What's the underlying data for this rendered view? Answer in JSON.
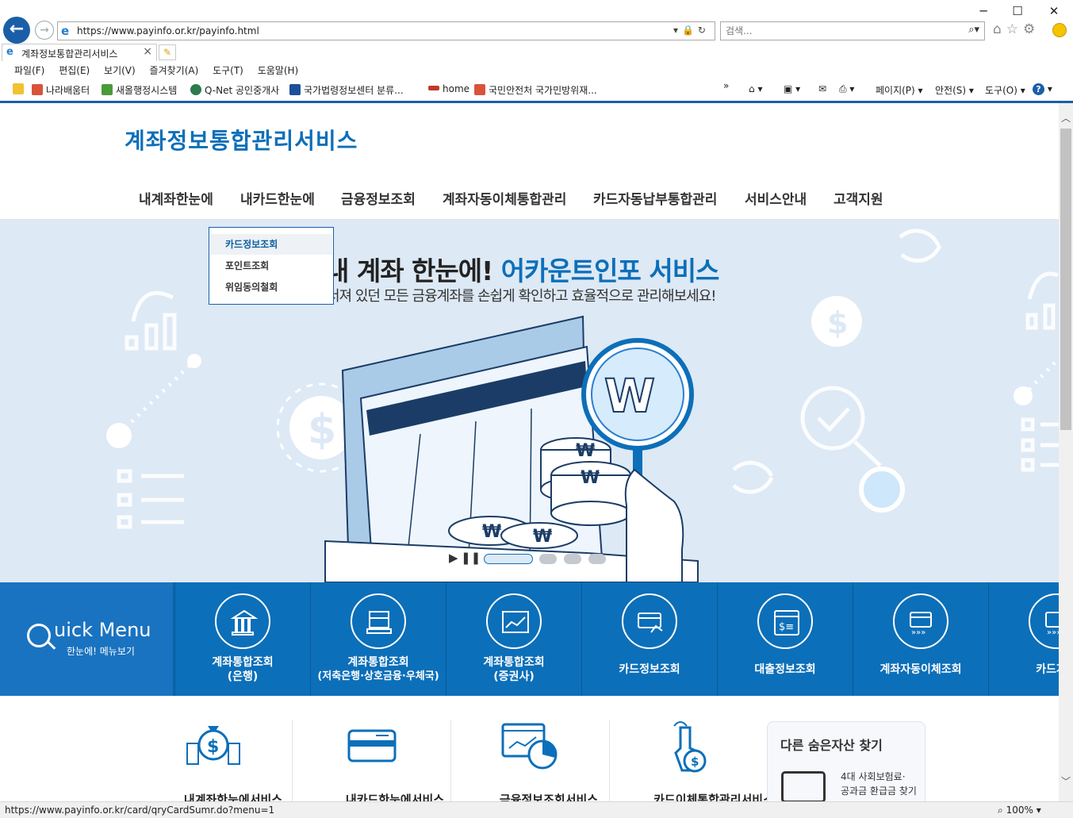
{
  "window": {
    "minimize": "─",
    "maximize": "☐",
    "close": "✕"
  },
  "address_bar": {
    "url": "https://www.payinfo.or.kr/payinfo.html"
  },
  "search": {
    "placeholder": "검색..."
  },
  "tab": {
    "title": "계좌정보통합관리서비스"
  },
  "menu": [
    "파일(F)",
    "편집(E)",
    "보기(V)",
    "즐겨찾기(A)",
    "도구(T)",
    "도움말(H)"
  ],
  "favorites": [
    "나라배움터",
    "새올행정시스템",
    "Q-Net 공인중개사",
    "국가법령정보센터  분류...",
    "home",
    "국민안전처 국가민방위재..."
  ],
  "command_bar": {
    "page": "페이지(P)",
    "safety": "안전(S)",
    "tools": "도구(O)"
  },
  "site": {
    "title": "계좌정보통합관리서비스",
    "gnb": [
      "내계좌한눈에",
      "내카드한눈에",
      "금융정보조회",
      "계좌자동이체통합관리",
      "카드자동납부통합관리",
      "서비스안내",
      "고객지원"
    ],
    "dropdown": [
      "카드정보조회",
      "포인트조회",
      "위임동의철회"
    ]
  },
  "hero": {
    "title_dark": "내 계좌 한눈에! ",
    "title_highlight": "어카운트인포 서비스",
    "subtitle": "서져 있던 모든 금융계좌를 손쉽게 확인하고 효율적으로 관리해보세요!",
    "current_slide": 1,
    "slide_count": 4
  },
  "quick_menu": {
    "title": "uick Menu",
    "subtitle": "한눈에! 메뉴보기",
    "items": [
      {
        "line1": "계좌통합조회",
        "line2": "(은행)"
      },
      {
        "line1": "계좌통합조회",
        "line2": "(저축은행·상호금융·우체국)"
      },
      {
        "line1": "계좌통합조회",
        "line2": "(증권사)"
      },
      {
        "line1": "카드정보조회",
        "line2": ""
      },
      {
        "line1": "대출정보조회",
        "line2": ""
      },
      {
        "line1": "계좌자동이체조회",
        "line2": ""
      },
      {
        "line1": "카드자동",
        "line2": ""
      }
    ]
  },
  "services": [
    "내계좌한눈에서비스",
    "내카드한눈에서비스",
    "금융정보조회서비스",
    "카드이체통합관리서비스"
  ],
  "hidden_assets": {
    "title": "다른 숨은자산 찾기",
    "desc1": "4대 사회보험료·",
    "desc2": "공과금 환급금 찾기"
  },
  "status": {
    "url": "https://www.payinfo.or.kr/card/qryCardSumr.do?menu=1",
    "zoom": "100%"
  },
  "colors": {
    "brand": "#0c6fb9",
    "ie_chrome": "#1a5ea8",
    "hero_bg": "#dde9f5"
  }
}
